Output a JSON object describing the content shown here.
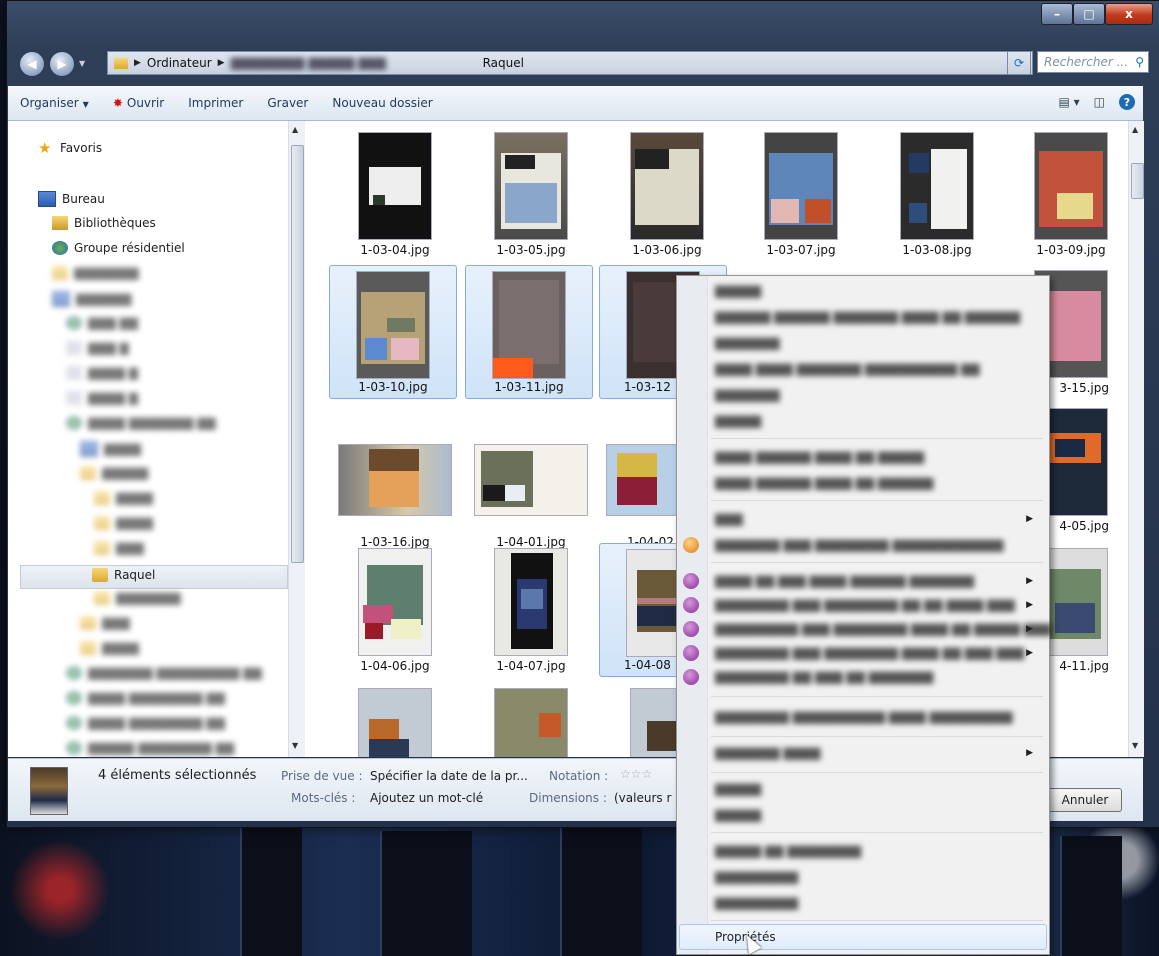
{
  "window": {
    "controls": [
      "–",
      "□",
      "x"
    ]
  },
  "address": {
    "crumbs": [
      "Ordinateur",
      "Raquel"
    ],
    "search_placeholder": "Rechercher ..."
  },
  "toolbar": {
    "organiser": "Organiser",
    "ouvrir": "Ouvrir",
    "imprimer": "Imprimer",
    "graver": "Graver",
    "nouveau_dossier": "Nouveau dossier"
  },
  "nav": {
    "favoris": "Favoris",
    "bureau": "Bureau",
    "bibliotheques": "Bibliothèques",
    "groupe": "Groupe résidentiel",
    "selected": "Raquel"
  },
  "files": [
    {
      "name": "1-03-04.jpg",
      "selected": false
    },
    {
      "name": "1-03-05.jpg",
      "selected": false
    },
    {
      "name": "1-03-06.jpg",
      "selected": false
    },
    {
      "name": "1-03-07.jpg",
      "selected": false
    },
    {
      "name": "1-03-08.jpg",
      "selected": false
    },
    {
      "name": "1-03-09.jpg",
      "selected": false
    },
    {
      "name": "1-03-10.jpg",
      "selected": true
    },
    {
      "name": "1-03-11.jpg",
      "selected": true
    },
    {
      "name": "1-03-12",
      "selected": true
    },
    {
      "name": "3-15.jpg",
      "selected": false
    },
    {
      "name": "1-03-16.jpg",
      "selected": false
    },
    {
      "name": "1-04-01.jpg",
      "selected": false
    },
    {
      "name": "1-04-02",
      "selected": false
    },
    {
      "name": "4-05.jpg",
      "selected": false
    },
    {
      "name": "1-04-06.jpg",
      "selected": false
    },
    {
      "name": "1-04-07.jpg",
      "selected": false
    },
    {
      "name": "1-04-08",
      "selected": true
    },
    {
      "name": "4-11.jpg",
      "selected": false
    }
  ],
  "details": {
    "count": "4 éléments sélectionnés",
    "prise_label": "Prise de vue :",
    "prise_value": "Spécifier la date de la pr...",
    "notation_label": "Notation :",
    "stars": "☆☆☆",
    "mots_label": "Mots-clés :",
    "mots_value": "Ajoutez un mot-clé",
    "dim_label": "Dimensions :",
    "dim_value": "(valeurs r",
    "cancel": "Annuler"
  },
  "context_menu": {
    "properties": "Propriétés"
  }
}
